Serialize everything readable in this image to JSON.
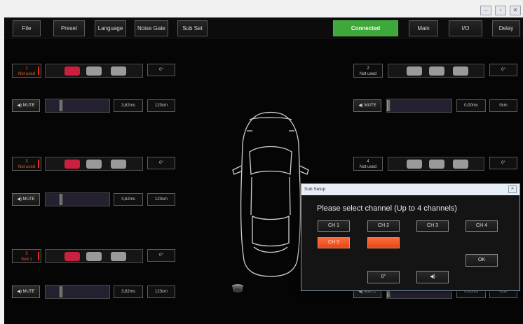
{
  "window": {
    "buttons": [
      "–",
      "▫",
      "✕"
    ]
  },
  "menu": {
    "file": "File",
    "preset": "Preset",
    "language": "Language",
    "noise_gate": "Noise Gate",
    "sub_set": "Sub Set",
    "status": "Connected",
    "main": "Main",
    "io": "I/O",
    "delay": "Delay"
  },
  "channels": [
    {
      "label_line1": "1",
      "label_line2": "Not used",
      "delay": "3,62ms",
      "distance": "123cm",
      "phase": "0°"
    },
    {
      "label_line1": "2",
      "label_line2": "Not used",
      "delay": "0,00ms",
      "distance": "0cm",
      "phase": "0°"
    },
    {
      "label_line1": "3",
      "label_line2": "Not used",
      "delay": "3,62ms",
      "distance": "123cm",
      "phase": "0°"
    },
    {
      "label_line1": "4",
      "label_line2": "Not used",
      "phase": "0°"
    },
    {
      "label_line1": "5",
      "label_line2": "Sub 1",
      "delay": "3,62ms",
      "distance": "123cm",
      "phase": "0°"
    },
    {
      "delay": "0,00ms",
      "distance": "0cm"
    }
  ],
  "mute_label": "◀) MUTE",
  "dialog": {
    "title": "Sub Setup",
    "close": "✕",
    "prompt": "Please select channel (Up to 4 channels)",
    "ch1": "CH 1",
    "ch2": "CH 2",
    "ch3": "CH 3",
    "ch4": "CH 4",
    "ch5": "CH 5",
    "ok": "OK",
    "phase": "0°",
    "speaker": "◀)"
  },
  "colors": {
    "connected": "#3fa83a",
    "selected": "#f25a28",
    "pill_active": "#c8203e",
    "pill_idle": "#9a9a9a"
  }
}
